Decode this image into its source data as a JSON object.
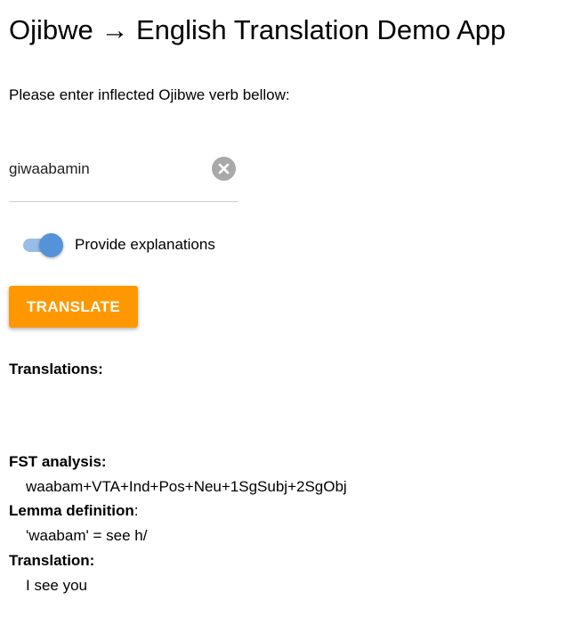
{
  "app": {
    "title": "Ojibwe → English Translation Demo App",
    "prompt": "Please enter inflected Ojibwe verb bellow:"
  },
  "input": {
    "value": "giwaabamin",
    "clear_icon": "close-circle-icon"
  },
  "toggle": {
    "label": "Provide explanations",
    "checked": true,
    "track_color": "#98bde6",
    "knob_color": "#5593d8"
  },
  "translate_button": {
    "label": "TRANSLATE",
    "color": "#ff9800"
  },
  "results": {
    "translations_heading": "Translations:",
    "fst_heading": "FST analysis:",
    "fst_value": "waabam+VTA+Ind+Pos+Neu+1SgSubj+2SgObj",
    "lemma_heading": "Lemma definition",
    "lemma_colon": ":",
    "lemma_value": "'waabam' = see h/",
    "translation_heading": "Translation:",
    "translation_value": "I see you"
  }
}
